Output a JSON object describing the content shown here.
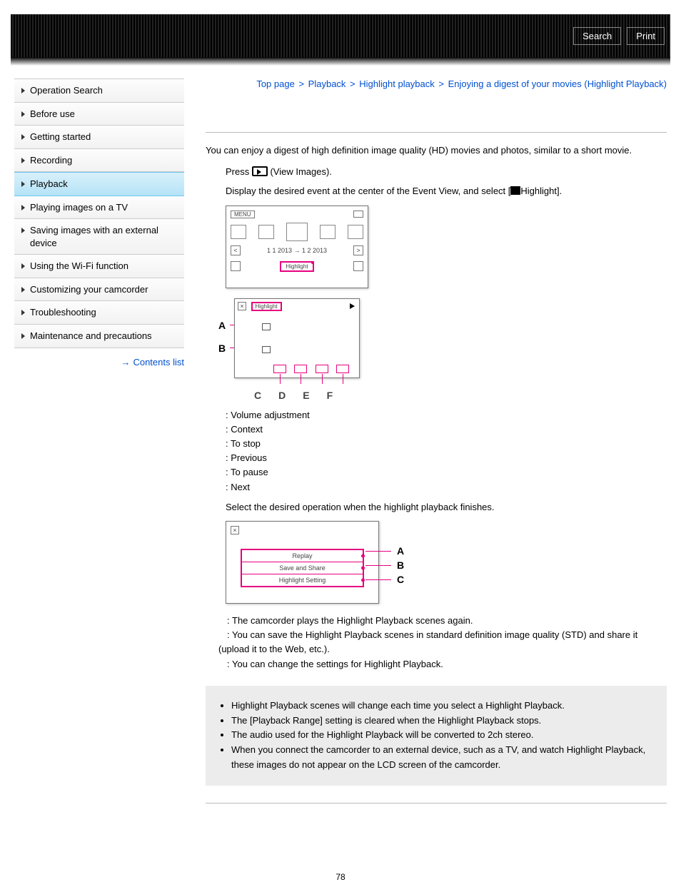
{
  "header": {
    "search": "Search",
    "print": "Print"
  },
  "nav": {
    "items": [
      "Operation Search",
      "Before use",
      "Getting started",
      "Recording",
      "Playback",
      "Playing images on a TV",
      "Saving images with an external device",
      "Using the Wi-Fi function",
      "Customizing your camcorder",
      "Troubleshooting",
      "Maintenance and precautions"
    ],
    "contents_link": "Contents list"
  },
  "breadcrumb": {
    "a": "Top page",
    "b": "Playback",
    "c": "Highlight playback",
    "d": "Enjoying a digest of your movies (Highlight Playback)"
  },
  "intro": "You can enjoy a digest of high definition image quality (HD) movies and photos, similar to a short movie.",
  "step1a": "Press ",
  "step1b": " (View Images).",
  "step2a": "Display the desired event at the center of the Event View, and select [",
  "step2b": "Highlight].",
  "diagram1": {
    "menu": "MENU",
    "date": "1 1 2013 → 1 2 2013",
    "highlight": "Highlight"
  },
  "diagram2": {
    "highlight": "Highlight",
    "labels": {
      "A": "A",
      "B": "B",
      "C": "C",
      "D": "D",
      "E": "E",
      "F": "F"
    }
  },
  "legend2": {
    "a": "Volume adjustment",
    "b": "Context",
    "c": "To stop",
    "d": "Previous",
    "e": "To pause",
    "f": "Next"
  },
  "step3": "Select the desired operation when the highlight playback finishes.",
  "diagram3": {
    "items": [
      "Replay",
      "Save and Share",
      "Highlight Setting"
    ],
    "labels": {
      "A": "A",
      "B": "B",
      "C": "C"
    }
  },
  "desc3": {
    "a": "The camcorder plays the Highlight Playback scenes again.",
    "b": "You can save the Highlight Playback scenes in standard definition image quality (STD) and share it (upload it to the Web, etc.).",
    "c": "You can change the settings for Highlight Playback."
  },
  "notes": [
    "Highlight Playback scenes will change each time you select a Highlight Playback.",
    "The [Playback Range] setting is cleared when the Highlight Playback stops.",
    "The audio used for the Highlight Playback will be converted to 2ch stereo.",
    "When you connect the camcorder to an external device, such as a TV, and watch Highlight Playback, these images do not appear on the LCD screen of the camcorder."
  ],
  "page_num": "78"
}
